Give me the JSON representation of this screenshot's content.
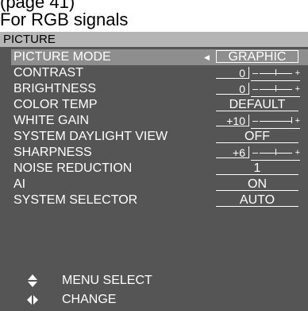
{
  "top_caption": "(page 41)",
  "heading": "For RGB signals",
  "menu_title": "PICTURE",
  "rows": [
    {
      "label": "PICTURE MODE",
      "value": "GRAPHIC",
      "selected": true
    },
    {
      "label": "CONTRAST",
      "value": "0",
      "slider_level": 0.5,
      "minus": "–",
      "plus": "+"
    },
    {
      "label": "BRIGHTNESS",
      "value": "0",
      "slider_level": 0.5,
      "minus": "–",
      "plus": "+"
    },
    {
      "label": "COLOR TEMP",
      "value": "DEFAULT"
    },
    {
      "label": "WHITE GAIN",
      "value": "+10",
      "slider_level": 1.0,
      "minus": "–",
      "plus": "+"
    },
    {
      "label": "SYSTEM DAYLIGHT VIEW",
      "value": "OFF"
    },
    {
      "label": "SHARPNESS",
      "value": "+6",
      "slider_level": 0.5,
      "minus": "–",
      "plus": "+"
    },
    {
      "label": "NOISE REDUCTION",
      "value": "1"
    },
    {
      "label": "AI",
      "value": "ON"
    },
    {
      "label": "SYSTEM SELECTOR",
      "value": "AUTO"
    }
  ],
  "footer": [
    {
      "icon": "up-down-arrows-icon",
      "label": "MENU SELECT"
    },
    {
      "icon": "left-right-arrows-icon",
      "label": "CHANGE"
    }
  ]
}
